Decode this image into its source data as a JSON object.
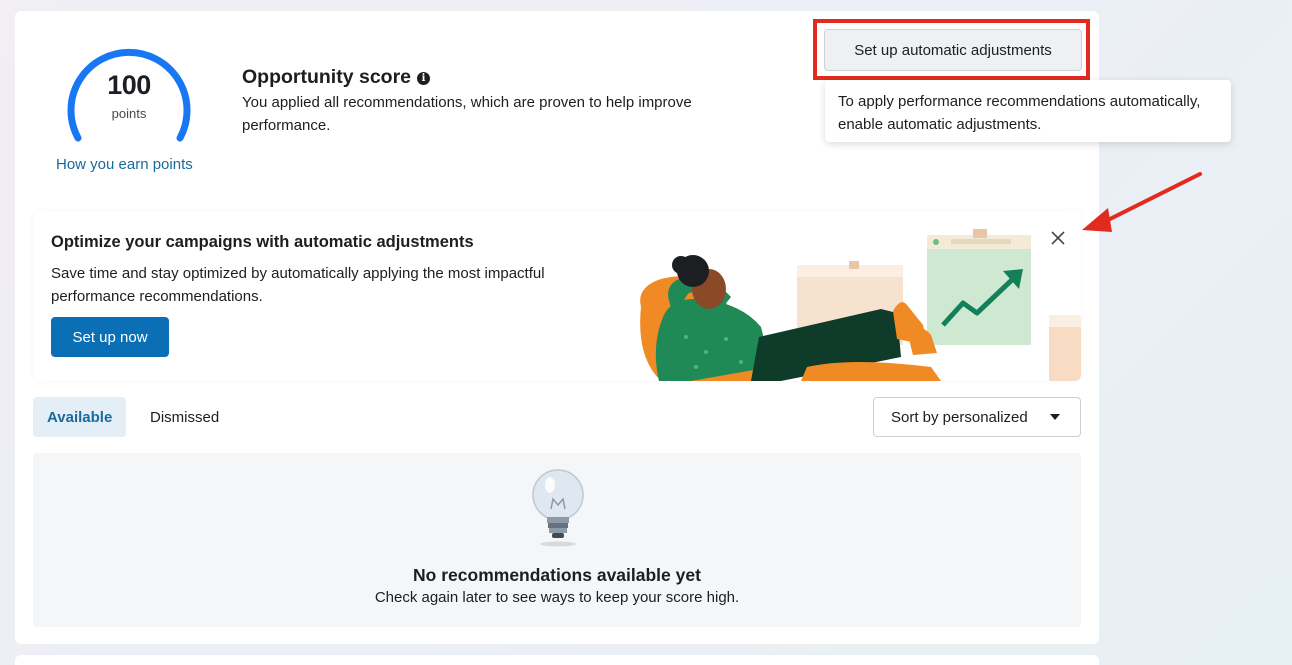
{
  "score": {
    "value": "100",
    "unit": "points",
    "link": "How you earn points",
    "gauge_fraction": 1.0,
    "gauge_color": "#1877f2"
  },
  "opportunity": {
    "title": "Opportunity score",
    "info_icon": "info-icon",
    "description": "You applied all recommendations, which are proven to help improve performance."
  },
  "auto_adjust": {
    "button_label": "Set up automatic adjustments",
    "tooltip": "To apply performance recommendations automatically, enable automatic adjustments.",
    "highlight_color": "#e02b1e"
  },
  "banner": {
    "title": "Optimize your campaigns with automatic adjustments",
    "description": "Save time and stay optimized by automatically applying the most impactful performance recommendations.",
    "cta_label": "Set up now",
    "close_icon": "close-icon",
    "cta_color": "#0b6fb6"
  },
  "tabs": [
    {
      "label": "Available",
      "selected": true
    },
    {
      "label": "Dismissed",
      "selected": false
    }
  ],
  "sort": {
    "label": "Sort by personalized",
    "icon": "caret-down-icon"
  },
  "empty_state": {
    "icon": "lightbulb-icon",
    "title": "No recommendations available yet",
    "description": "Check again later to see ways to keep your score high."
  }
}
